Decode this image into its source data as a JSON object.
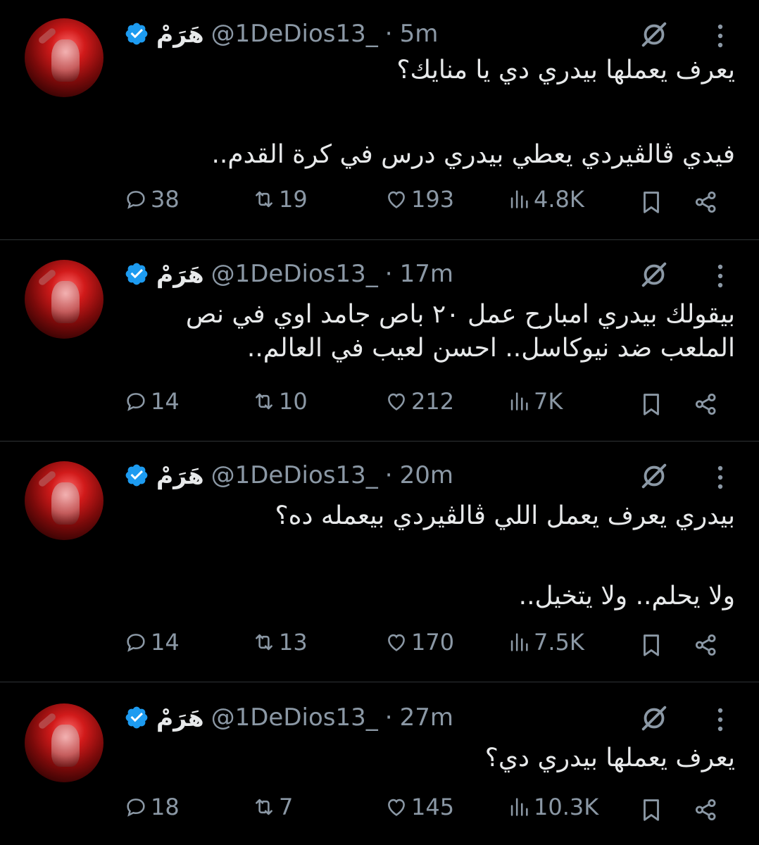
{
  "tweets": [
    {
      "name": "هَرَمْ",
      "handle": "@1DeDios13_",
      "separator": "·",
      "time": "5m",
      "lines": [
        "يعرف يعملها بيدري دي يا منايك؟",
        "",
        "فيدي ڤالڤيردي يعطي بيدري درس في كرة القدم.."
      ],
      "replies": "38",
      "reposts": "19",
      "likes": "193",
      "views": "4.8K"
    },
    {
      "name": "هَرَمْ",
      "handle": "@1DeDios13_",
      "separator": "·",
      "time": "17m",
      "lines": [
        "بيقولك بيدري امبارح عمل ٢٠ باص جامد اوي في نص",
        "الملعب ضد نيوكاسل.. احسن لعيب في العالم.."
      ],
      "replies": "14",
      "reposts": "10",
      "likes": "212",
      "views": "7K"
    },
    {
      "name": "هَرَمْ",
      "handle": "@1DeDios13_",
      "separator": "·",
      "time": "20m",
      "lines": [
        "بيدري يعرف يعمل اللي ڤالڤيردي بيعمله ده؟",
        "",
        "ولا يحلم.. ولا يتخيل.."
      ],
      "replies": "14",
      "reposts": "13",
      "likes": "170",
      "views": "7.5K"
    },
    {
      "name": "هَرَمْ",
      "handle": "@1DeDios13_",
      "separator": "·",
      "time": "27m",
      "lines": [
        "يعرف يعملها بيدري دي؟"
      ],
      "replies": "18",
      "reposts": "7",
      "likes": "145",
      "views": "10.3K"
    }
  ],
  "icons": {
    "verified": "verified-badge-icon",
    "grok": "grok-icon",
    "more": "more-icon",
    "reply": "reply-icon",
    "repost": "repost-icon",
    "like": "like-icon",
    "views": "views-icon",
    "bookmark": "bookmark-icon",
    "share": "share-icon"
  },
  "colors": {
    "background": "#000000",
    "text": "#e7e9ea",
    "muted": "#8b98a5",
    "verified": "#1d9bf0",
    "divider": "#2f3336"
  }
}
